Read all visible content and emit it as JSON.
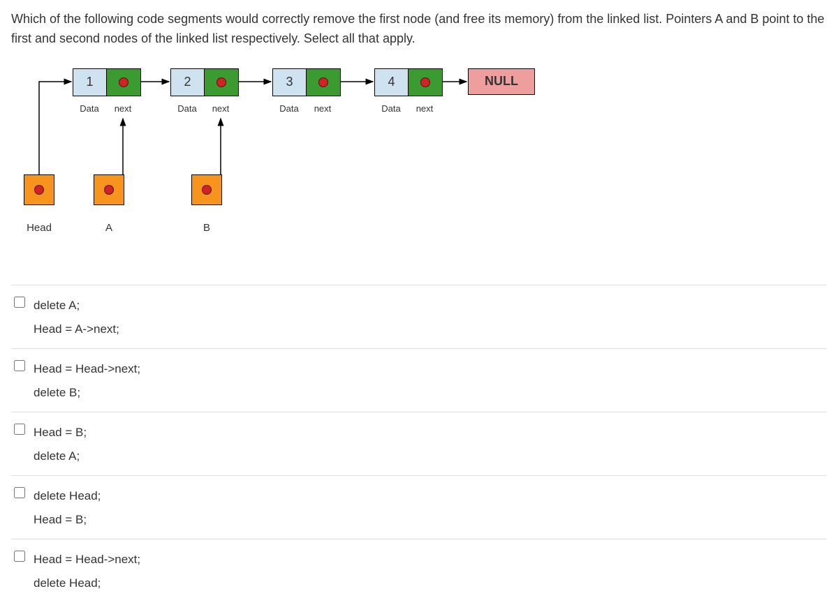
{
  "question": "Which of the following code segments would correctly remove the first node (and free its memory) from the linked list. Pointers A and B point to the first and second nodes of the linked list respectively. Select all that apply.",
  "nodes": [
    {
      "value": "1",
      "data_label": "Data",
      "next_label": "next"
    },
    {
      "value": "2",
      "data_label": "Data",
      "next_label": "next"
    },
    {
      "value": "3",
      "data_label": "Data",
      "next_label": "next"
    },
    {
      "value": "4",
      "data_label": "Data",
      "next_label": "next"
    }
  ],
  "null_label": "NULL",
  "pointers": {
    "head": "Head",
    "a": "A",
    "b": "B"
  },
  "options": [
    "delete A;\nHead = A->next;",
    "Head = Head->next;\ndelete B;",
    "Head = B;\ndelete A;",
    "delete Head;\nHead = B;",
    "Head = Head->next;\ndelete Head;"
  ],
  "colors": {
    "data_bg": "#cee2f0",
    "next_bg": "#3b9a30",
    "ptr_bg": "#f7941d",
    "null_bg": "#ef9e9e",
    "dot": "#d02424"
  }
}
